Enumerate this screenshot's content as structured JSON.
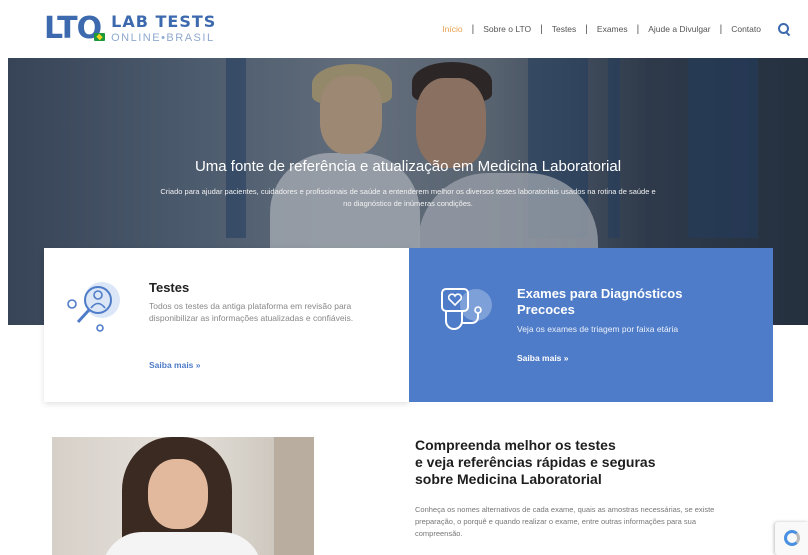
{
  "header": {
    "logo_mark": "LTO",
    "logo_title": "LAB TESTS",
    "logo_subtitle": "ONLINE•BRASIL",
    "nav": [
      {
        "label": "Início"
      },
      {
        "label": "Sobre o LTO"
      },
      {
        "label": "Testes"
      },
      {
        "label": "Exames"
      },
      {
        "label": "Ajude a Divulgar"
      },
      {
        "label": "Contato"
      }
    ],
    "separator": "|"
  },
  "hero": {
    "title": "Uma fonte de referência e atualização em Medicina Laboratorial",
    "subtitle": "Criado para ajudar pacientes, cuidadores e profissionais de saúde a entenderem melhor os diversos testes laboratoriais usados na rotina de saúde e no diagnóstico de inúmeras condições."
  },
  "cards": {
    "testes": {
      "title": "Testes",
      "text": "Todos os testes da antiga plataforma em revisão para disponibilizar as informações atualizadas e confiáveis.",
      "link": "Saiba mais »",
      "icon": "magnifier-person-icon"
    },
    "exames": {
      "title": "Exames para Diagnósticos Precoces",
      "text": "Veja os exames de triagem por faixa etária",
      "link": "Saiba mais »",
      "icon": "stethoscope-heart-icon"
    }
  },
  "section": {
    "title_lines": [
      "Compreenda melhor os testes",
      "e veja referências rápidas e seguras",
      "sobre Medicina Laboratorial"
    ],
    "text": "Conheça os nomes alternativos de cada exame, quais as amostras necessárias, se existe preparação, o porquê e quando realizar o exame, entre outras informações para sua compreensão."
  },
  "colors": {
    "brand": "#3d6aae",
    "accent_blue": "#4f7cc8",
    "nav_active": "#e8a14c"
  }
}
